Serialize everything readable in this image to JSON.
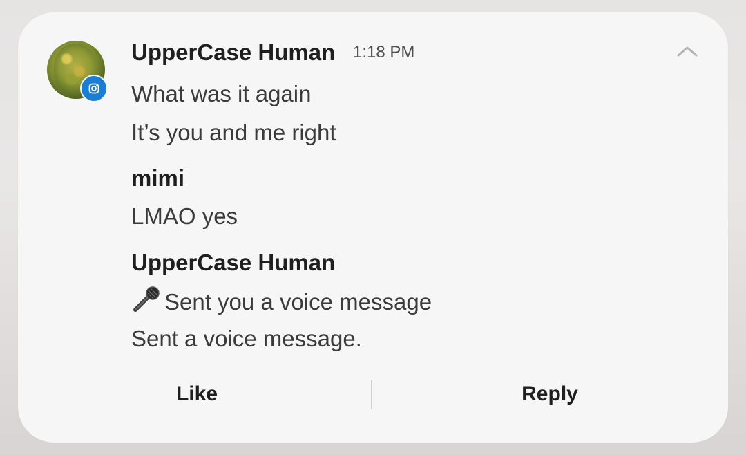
{
  "notification": {
    "app_icon": "instagram-icon",
    "avatar": "avatar-fruit-photo",
    "header": {
      "sender": "UpperCase Human",
      "time": "1:18 PM"
    },
    "messages": [
      {
        "text": "What was it again"
      },
      {
        "text": "It’s you and me right"
      }
    ],
    "group2": {
      "sender": "mimi",
      "message": "LMAO yes"
    },
    "group3": {
      "sender": "UpperCase Human",
      "voice_message": "Sent you a voice message",
      "note": "Sent a voice message."
    },
    "actions": {
      "like": "Like",
      "reply": "Reply"
    },
    "collapse_icon": "chevron-up-icon"
  },
  "colors": {
    "badge": "#1a7ed4",
    "card": "#f6f6f6",
    "text": "#3b3b3b"
  }
}
